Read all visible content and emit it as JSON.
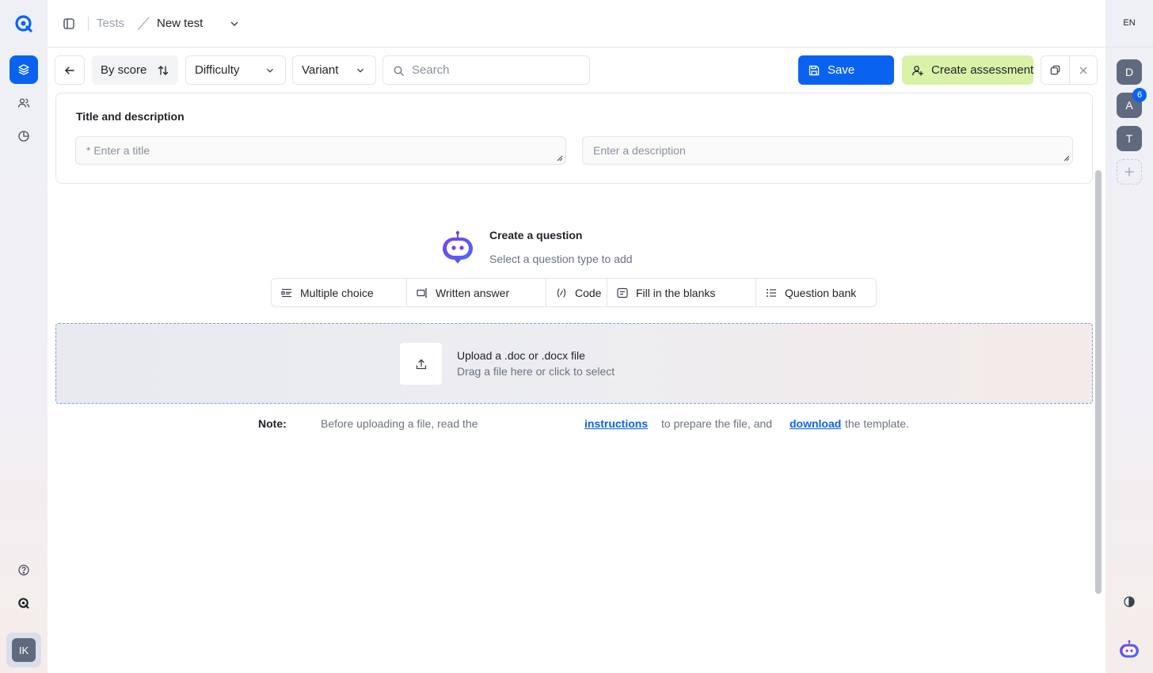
{
  "breadcrumb": {
    "parent": "Tests",
    "current": "New test"
  },
  "toolbar": {
    "sort_label": "By score",
    "difficulty_label": "Difficulty",
    "variant_label": "Variant",
    "search_placeholder": "Search",
    "save_label": "Save",
    "create_assessment_label": "Create assessment"
  },
  "title_card": {
    "heading": "Title and description",
    "title_placeholder": "* Enter a title",
    "description_placeholder": "Enter a description"
  },
  "create_question": {
    "title": "Create a question",
    "subtitle": "Select a question type to add",
    "types": [
      {
        "label": "Multiple choice",
        "icon": "list-lines-icon"
      },
      {
        "label": "Written answer",
        "icon": "pen-line-icon"
      },
      {
        "label": "Code",
        "icon": "code-icon"
      },
      {
        "label": "Fill in the blanks",
        "icon": "form-fill-icon"
      },
      {
        "label": "Question bank",
        "icon": "bullet-list-icon"
      }
    ]
  },
  "upload": {
    "title": "Upload a .doc or .docx file",
    "subtitle": "Drag a file here or click to select"
  },
  "note": {
    "label": "Note:",
    "text_before": "Before uploading a file, read the",
    "link_instructions": "instructions",
    "text_middle": "to prepare the file, and",
    "link_download": "download",
    "text_after": "the template."
  },
  "right_rail": {
    "language": "EN",
    "workspaces": [
      {
        "initial": "D",
        "badge": ""
      },
      {
        "initial": "A",
        "badge": "6"
      },
      {
        "initial": "T",
        "badge": ""
      }
    ]
  },
  "user": {
    "initials": "IK"
  },
  "colors": {
    "primary": "#0a63f0",
    "accent_green": "#d9f2a8",
    "brand_purple": "#7b3fe4"
  }
}
